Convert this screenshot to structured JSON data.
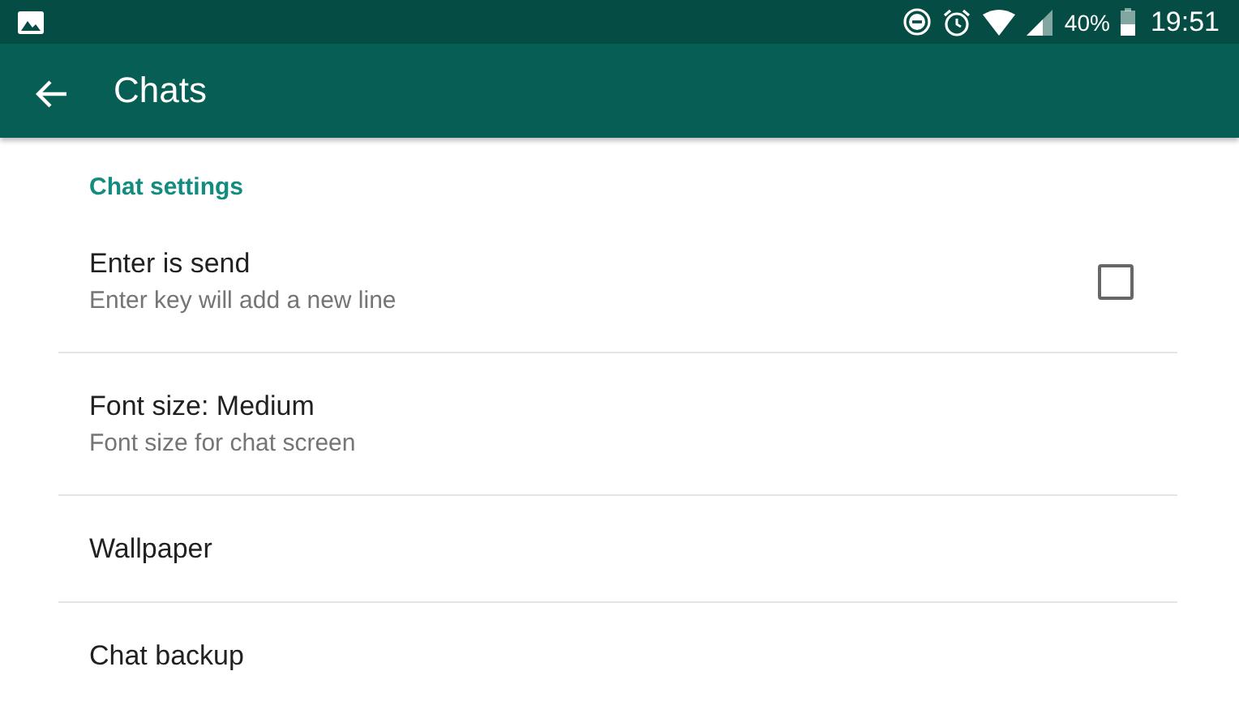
{
  "status_bar": {
    "battery_percent": "40%",
    "time": "19:51"
  },
  "app_bar": {
    "title": "Chats"
  },
  "section": {
    "title": "Chat settings"
  },
  "items": [
    {
      "kind": "checkbox",
      "title": "Enter is send",
      "subtitle": "Enter key will add a new line",
      "checked": false
    },
    {
      "kind": "plain",
      "title": "Font size: Medium",
      "subtitle": "Font size for chat screen"
    },
    {
      "kind": "plain",
      "title": "Wallpaper"
    },
    {
      "kind": "plain",
      "title": "Chat backup"
    }
  ]
}
